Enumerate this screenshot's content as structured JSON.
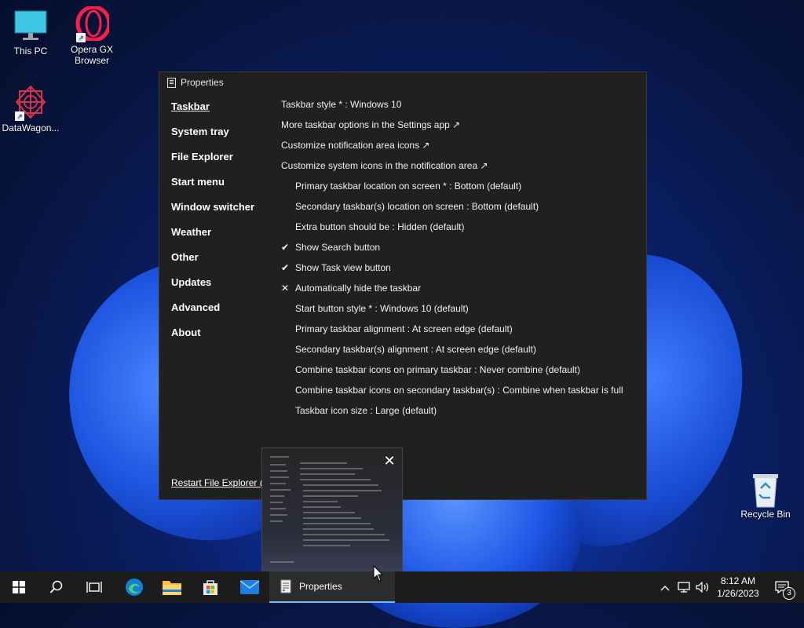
{
  "desktop": {
    "icons": [
      {
        "label": "This PC"
      },
      {
        "label": "Opera GX Browser"
      },
      {
        "label": "DataWagon..."
      },
      {
        "label": "Recycle Bin"
      }
    ]
  },
  "window": {
    "title": "Properties",
    "nav": [
      {
        "label": "Taskbar"
      },
      {
        "label": "System tray"
      },
      {
        "label": "File Explorer"
      },
      {
        "label": "Start menu"
      },
      {
        "label": "Window switcher"
      },
      {
        "label": "Weather"
      },
      {
        "label": "Other"
      },
      {
        "label": "Updates"
      },
      {
        "label": "Advanced"
      },
      {
        "label": "About"
      }
    ],
    "settings": [
      {
        "label": "Taskbar style * : Windows 10",
        "mark": ""
      },
      {
        "label": "More taskbar options in the Settings app ↗",
        "mark": ""
      },
      {
        "label": "Customize notification area icons ↗",
        "mark": ""
      },
      {
        "label": "Customize system icons in the notification area ↗",
        "mark": ""
      },
      {
        "label": "Primary taskbar location on screen * : Bottom (default)",
        "mark": ""
      },
      {
        "label": "Secondary taskbar(s) location on screen : Bottom (default)",
        "mark": ""
      },
      {
        "label": "Extra button should be : Hidden (default)",
        "mark": ""
      },
      {
        "label": "Show Search button",
        "mark": "✔"
      },
      {
        "label": "Show Task view button",
        "mark": "✔"
      },
      {
        "label": "Automatically hide the taskbar",
        "mark": "✕"
      },
      {
        "label": "Start button style * : Windows 10 (default)",
        "mark": ""
      },
      {
        "label": "Primary taskbar alignment : At screen edge (default)",
        "mark": ""
      },
      {
        "label": "Secondary taskbar(s) alignment : At screen edge (default)",
        "mark": ""
      },
      {
        "label": "Combine taskbar icons on primary taskbar : Never combine (default)",
        "mark": ""
      },
      {
        "label": "Combine taskbar icons on secondary taskbar(s) : Combine when taskbar is full",
        "mark": ""
      },
      {
        "label": "Taskbar icon size : Large (default)",
        "mark": ""
      }
    ],
    "restart_label": "Restart File Explorer (*)"
  },
  "thumbnail": {
    "close_glyph": "✕"
  },
  "taskbar": {
    "active_app_label": "Properties",
    "time": "8:12 AM",
    "date": "1/26/2023",
    "notification_count": "3"
  },
  "colors": {
    "accent": "#76b9ed",
    "window_bg": "#202020",
    "taskbar_bg": "#1c1c1c"
  }
}
